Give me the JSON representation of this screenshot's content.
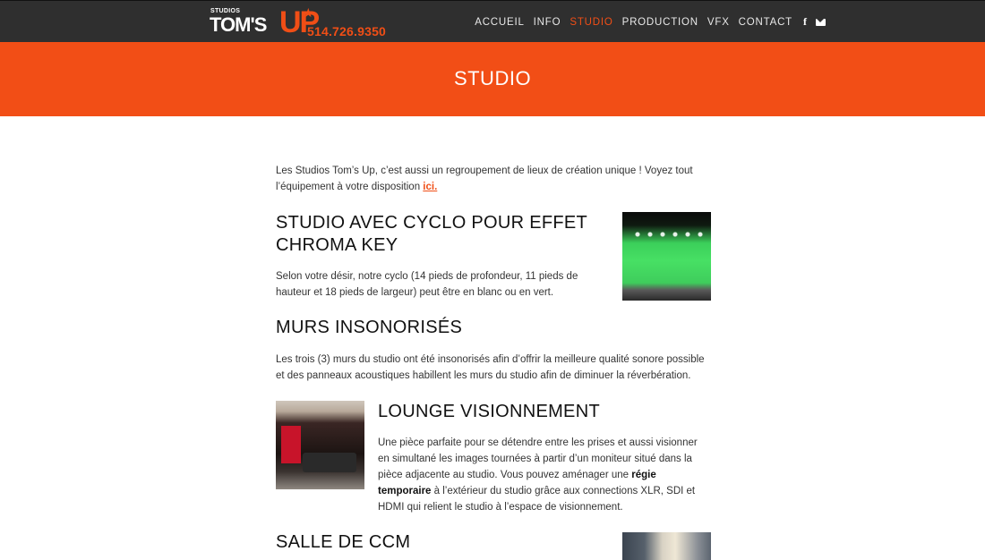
{
  "header": {
    "logo": {
      "studios": "STUDIOS",
      "toms": "TOM'S",
      "up": "UP",
      "phone": "514.726.9350"
    },
    "nav": [
      {
        "label": "ACCUEIL",
        "active": false
      },
      {
        "label": "INFO",
        "active": false
      },
      {
        "label": "STUDIO",
        "active": true
      },
      {
        "label": "PRODUCTION",
        "active": false
      },
      {
        "label": "VFX",
        "active": false
      },
      {
        "label": "CONTACT",
        "active": false
      }
    ],
    "icons": [
      "facebook-icon",
      "mail-icon"
    ]
  },
  "banner": {
    "title": "STUDIO"
  },
  "intro": {
    "text": "Les Studios Tom’s Up, c’est aussi un regroupement de lieux de création unique ! Voyez tout l’équipement à votre disposition ",
    "link": "ici."
  },
  "sections": {
    "cyclo": {
      "title": "STUDIO AVEC CYCLO POUR EFFET CHROMA KEY",
      "text": "Selon votre désir, notre cyclo (14 pieds de profondeur, 11 pieds de hauteur et 18 pieds de largeur) peut être en blanc ou en vert."
    },
    "murs": {
      "title": "MURS INSONORISÉS",
      "text": "Les trois (3) murs du studio ont été insonorisés afin d’offrir la meilleure qualité sonore possible et des panneaux acoustiques habillent les murs du studio afin de diminuer la réverbération."
    },
    "lounge": {
      "title": "LOUNGE VISIONNEMENT",
      "text_a": "Une pièce parfaite pour se détendre entre les prises et aussi visionner en simultané les images tournées à partir d’un moniteur situé dans la pièce adjacente au studio. Vous pouvez aménager une ",
      "bold": "régie temporaire",
      "text_b": " à l’extérieur du studio grâce aux connections XLR, SDI et HDMI qui relient le studio à l’espace de visionnement."
    },
    "ccm": {
      "title": "SALLE DE CCM"
    }
  },
  "colors": {
    "accent": "#f24e16",
    "header_bg": "#2f2f2f"
  }
}
